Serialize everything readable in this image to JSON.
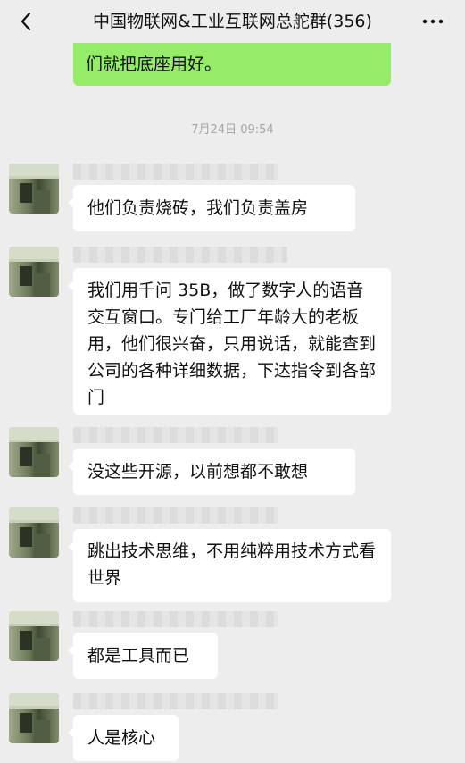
{
  "header": {
    "title": "中国物联网&工业互联网总舵群(356)"
  },
  "top_bubble": {
    "text": "们就把底座用好。"
  },
  "timestamp": "7月24日 09:54",
  "messages": [
    {
      "text": "他们负责烧砖，我们负责盖房"
    },
    {
      "text": "我们用千问 35B，做了数字人的语音交互窗口。专门给工厂年龄大的老板用，他们很兴奋，只用说话，就能查到公司的各种详细数据，下达指令到各部门"
    },
    {
      "text": "没这些开源，以前想都不敢想"
    },
    {
      "text": "跳出技术思维，不用纯粹用技术方式看世界"
    },
    {
      "text": "都是工具而已"
    },
    {
      "text": "人是核心"
    }
  ],
  "colors": {
    "background": "#ededed",
    "sent_bubble": "#95ec69",
    "received_bubble": "#ffffff"
  },
  "icons": {
    "back": "chevron-left-icon",
    "more": "more-horizontal-icon"
  }
}
